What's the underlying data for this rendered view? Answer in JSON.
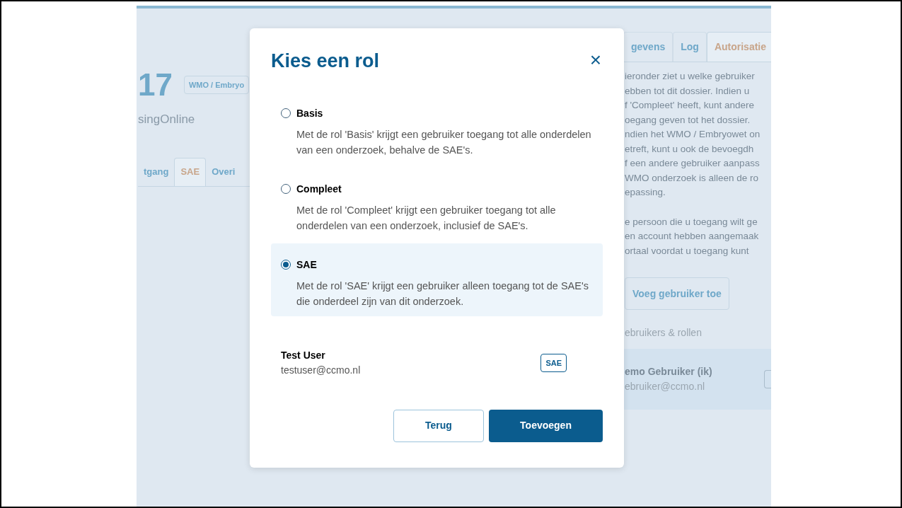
{
  "background": {
    "title": "17",
    "tag": "WMO / Embryo",
    "subtitle": "singOnline",
    "tabs": [
      {
        "label": "tgang",
        "selected": false
      },
      {
        "label": "SAE",
        "selected": true
      },
      {
        "label": "Overi",
        "selected": false
      }
    ],
    "right_tabs": [
      {
        "label": "gevens",
        "selected": false
      },
      {
        "label": "Log",
        "selected": false
      },
      {
        "label": "Autorisatie",
        "selected": true
      }
    ],
    "paragraphs": [
      [
        "ieronder ziet u welke gebruiker",
        "ebben tot dit dossier. Indien u",
        "f 'Compleet' heeft, kunt andere",
        "oegang geven tot het dossier.",
        "ndien het WMO / Embryowet on",
        "etreft, kunt u ook de bevoegdh",
        "f een andere gebruiker aanpass",
        "WMO onderzoek is alleen de ro",
        "epassing."
      ],
      [
        "e persoon die u toegang wilt ge",
        "en account hebben aangemaak",
        "ortaal voordat u toegang kunt"
      ]
    ],
    "add_button": "Voeg gebruiker toe",
    "section_heading": "ebruikers & rollen",
    "user": {
      "name": "emo Gebruiker (ik)",
      "email": "ebruiker@ccmo.nl"
    }
  },
  "dialog": {
    "title": "Kies een rol",
    "close": "×",
    "options": [
      {
        "label": "Basis",
        "description": "Met de rol 'Basis' krijgt een gebruiker toegang tot alle onderdelen van een onderzoek, behalve de SAE's.",
        "selected": false
      },
      {
        "label": "Compleet",
        "description": "Met de rol 'Compleet' krijgt een gebruiker toegang tot alle onderdelen van een onderzoek, inclusief de SAE's.",
        "selected": false
      },
      {
        "label": "SAE",
        "description": "Met de rol 'SAE' krijgt een gebruiker alleen toegang tot de SAE's die onderdeel zijn van dit onderzoek.",
        "selected": true
      }
    ],
    "user": {
      "name": "Test User",
      "email": "testuser@ccmo.nl",
      "role": "SAE"
    },
    "buttons": [
      {
        "label": "Terug",
        "kind": "secondary"
      },
      {
        "label": "Toevoegen",
        "kind": "primary"
      }
    ]
  }
}
